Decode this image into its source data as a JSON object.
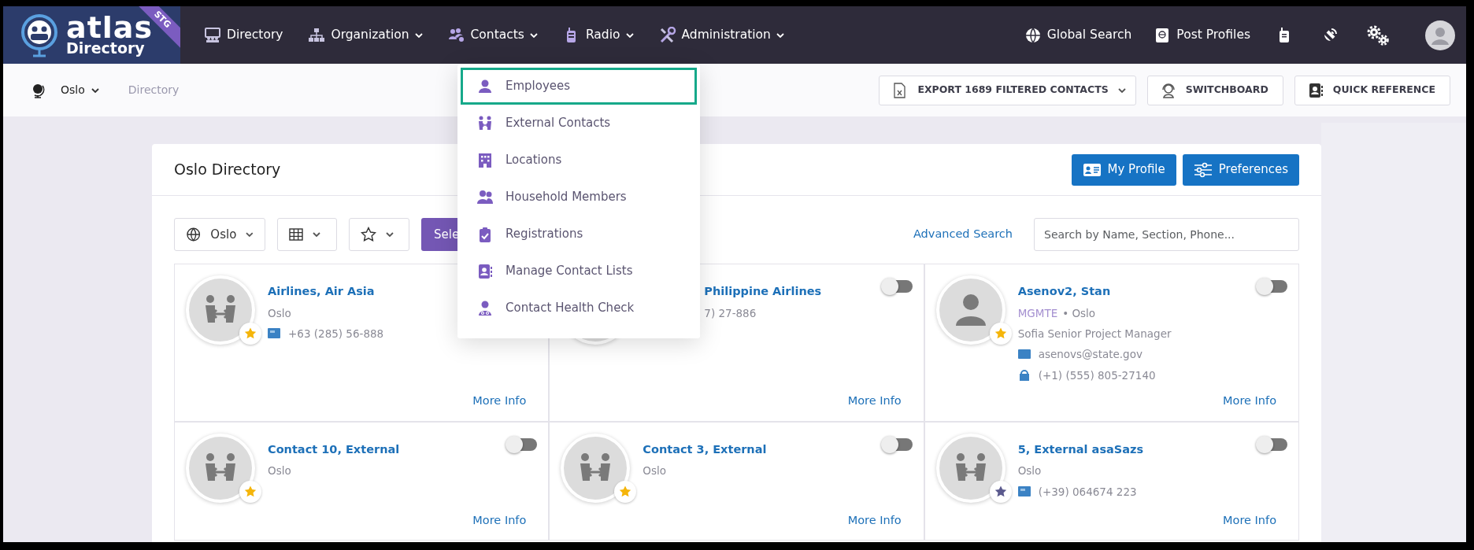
{
  "navbar": {
    "logo": {
      "title": "atlas",
      "subtitle": "Directory",
      "ribbon": "STG"
    },
    "menu": [
      {
        "label": "Directory",
        "dropdown": false
      },
      {
        "label": "Organization",
        "dropdown": true
      },
      {
        "label": "Contacts",
        "dropdown": true
      },
      {
        "label": "Radio",
        "dropdown": true
      },
      {
        "label": "Administration",
        "dropdown": true
      }
    ],
    "links": [
      "Global Search",
      "Post Profiles"
    ]
  },
  "breadcrumb": {
    "location": "Oslo",
    "page": "Directory"
  },
  "actions": [
    {
      "label": "EXPORT 1689 FILTERED CONTACTS",
      "dropdown": true
    },
    {
      "label": "SWITCHBOARD",
      "dropdown": false
    },
    {
      "label": "QUICK REFERENCE",
      "dropdown": false
    }
  ],
  "contacts_menu": [
    {
      "label": "Employees",
      "selected": true
    },
    {
      "label": "External Contacts",
      "selected": false
    },
    {
      "label": "Locations",
      "selected": false
    },
    {
      "label": "Household Members",
      "selected": false
    },
    {
      "label": "Registrations",
      "selected": false
    },
    {
      "label": "Manage Contact Lists",
      "selected": false
    },
    {
      "label": "Contact Health Check",
      "selected": false
    }
  ],
  "directory": {
    "title": "Oslo Directory",
    "header_buttons": [
      "My Profile",
      "Preferences"
    ],
    "location_filter": "Oslo",
    "select_button": "Sele",
    "advanced_search": "Advanced Search",
    "search": {
      "placeholder": "Search by Name, Section, Phone..."
    },
    "cards": [
      {
        "kind": "external",
        "starred": true,
        "name": "Airlines, Air Asia",
        "lines": [
          {
            "kind": "text",
            "text": "Oslo"
          },
          {
            "kind": "fax",
            "text": "+63 (285) 56-888"
          }
        ],
        "more": "More Info"
      },
      {
        "toggle_on": false,
        "name": "Philippine Airlines",
        "lines": [
          {
            "kind": "text",
            "text": "7) 27-886"
          }
        ],
        "more": "More Info"
      },
      {
        "kind": "person",
        "starred": true,
        "toggle_on": false,
        "name": "Asenov2, Stan",
        "lines": [
          {
            "kind": "section",
            "section": "MGMTE",
            "separator": "•",
            "text": "Oslo"
          },
          {
            "kind": "text",
            "text": "Sofia Senior Project Manager"
          },
          {
            "kind": "email",
            "text": "asenovs@state.gov"
          },
          {
            "kind": "phone",
            "text": "(+1) (555) 805-27140"
          }
        ],
        "more": "More Info"
      },
      {
        "kind": "external",
        "starred": true,
        "toggle_on": false,
        "name": "Contact 10, External",
        "lines": [
          {
            "kind": "text",
            "text": "Oslo"
          }
        ],
        "more": "More Info"
      },
      {
        "kind": "external",
        "starred": true,
        "toggle_on": false,
        "name": "Contact 3, External",
        "lines": [
          {
            "kind": "text",
            "text": "Oslo"
          }
        ],
        "more": "More Info"
      },
      {
        "kind": "external",
        "starred": false,
        "toggle_on": false,
        "name": "5, External asaSazs",
        "lines": [
          {
            "kind": "text",
            "text": "Oslo"
          },
          {
            "kind": "fax",
            "text": "(+39) 064674 223"
          }
        ],
        "more": "More Info"
      }
    ]
  }
}
